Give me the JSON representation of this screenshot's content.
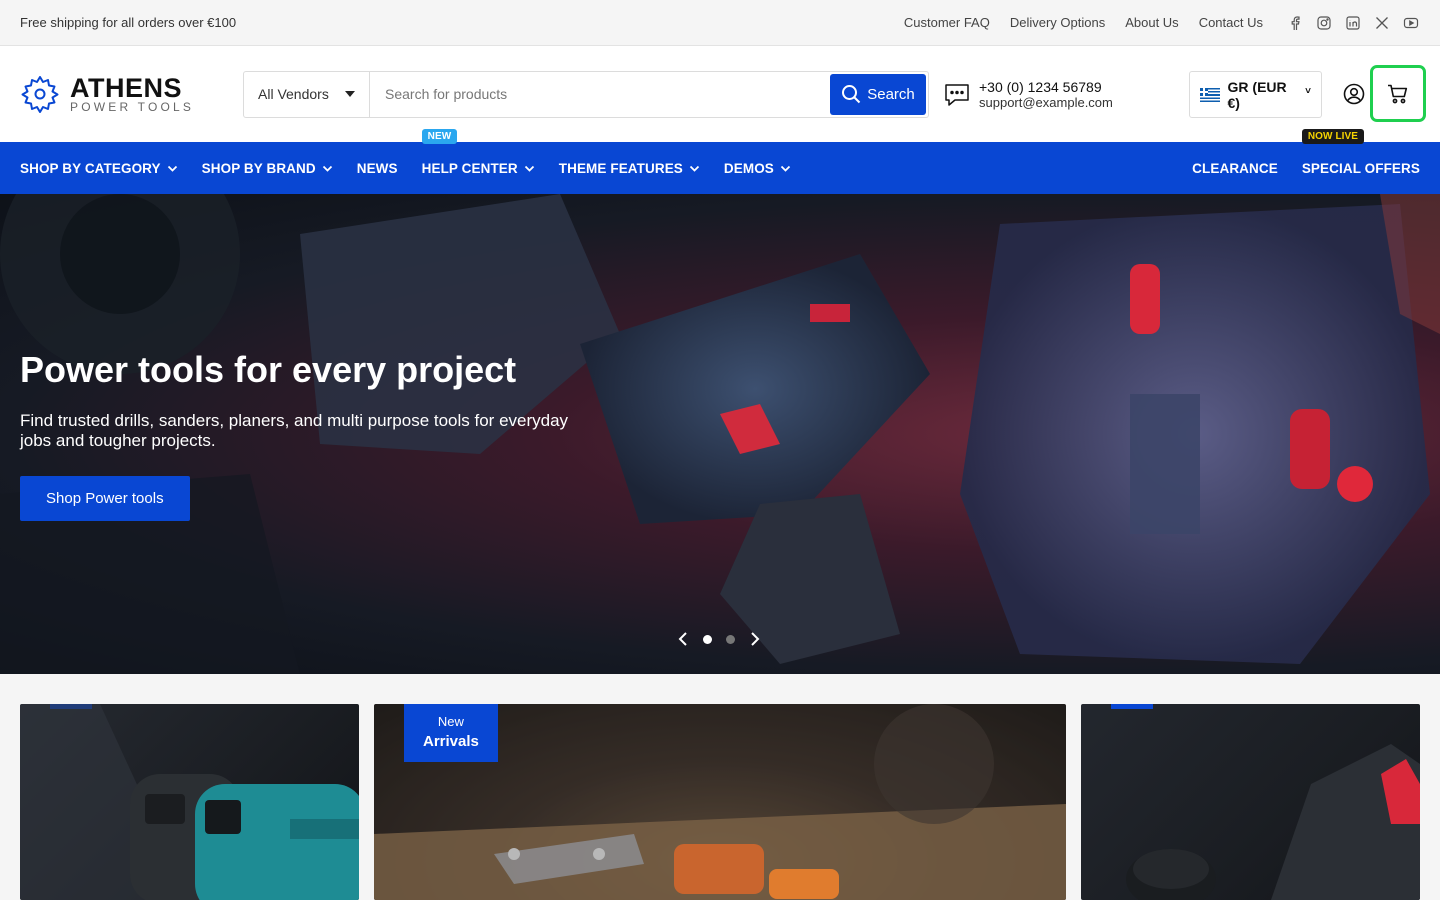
{
  "topbar": {
    "shipping": "Free shipping for all orders over €100",
    "links": [
      "Customer FAQ",
      "Delivery Options",
      "About Us",
      "Contact Us"
    ],
    "socials": [
      "facebook-icon",
      "instagram-icon",
      "linkedin-icon",
      "x-icon",
      "youtube-icon"
    ]
  },
  "logo": {
    "line1": "ATHENS",
    "line2": "POWER TOOLS"
  },
  "search": {
    "vendor": "All Vendors",
    "placeholder": "Search for products",
    "button": "Search"
  },
  "contact": {
    "phone": "+30 (0) 1234 56789",
    "email": "support@example.com"
  },
  "currency": {
    "label": "GR (EUR €)"
  },
  "nav": {
    "shop_by_category": "SHOP BY CATEGORY",
    "shop_by_brand": "SHOP BY BRAND",
    "news": "NEWS",
    "help_center": "HELP CENTER",
    "help_badge": "NEW",
    "theme_features": "THEME FEATURES",
    "demos": "DEMOS",
    "clearance": "CLEARANCE",
    "special_offers": "SPECIAL OFFERS",
    "special_badge": "NOW LIVE"
  },
  "hero": {
    "title": "Power tools for every project",
    "subtitle": "Find trusted drills, sanders, planers, and multi purpose tools for everyday jobs and tougher projects.",
    "button": "Shop Power tools",
    "slides": 2,
    "active_slide": 1
  },
  "promos": {
    "card2_badge_line1": "New",
    "card2_badge_line2": "Arrivals"
  },
  "colors": {
    "brand_blue": "#0947d3",
    "highlight_green": "#1fcf4f",
    "new_badge": "#2aa7ef",
    "live_badge_text": "#f5d300"
  }
}
